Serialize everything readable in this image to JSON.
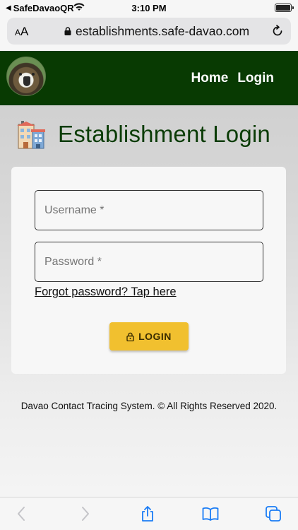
{
  "status_bar": {
    "back_app": "SafeDavaoQR",
    "time": "3:10 PM"
  },
  "browser": {
    "text_size_label": "AA",
    "url": "establishments.safe-davao.com"
  },
  "header": {
    "nav": [
      "Home",
      "Login"
    ]
  },
  "page": {
    "title": "Establishment Login"
  },
  "form": {
    "username_placeholder": "Username *",
    "password_placeholder": "Password *",
    "forgot_link": "Forgot password? Tap here",
    "login_label": "LOGIN"
  },
  "footer": {
    "text": "Davao Contact Tracing System. © All Rights Reserved 2020."
  },
  "colors": {
    "header_bg": "#083a02",
    "title": "#0b3c06",
    "login_button": "#f1c02f",
    "ios_blue": "#1a7cf5"
  },
  "icons": {
    "logo": "philippine-eagle-logo",
    "title": "building-icon",
    "browser_lock": "lock-icon",
    "reload": "reload-icon",
    "login": "padlock-icon",
    "toolbar": [
      "back-icon",
      "forward-icon",
      "share-icon",
      "bookmarks-icon",
      "tabs-icon"
    ]
  }
}
